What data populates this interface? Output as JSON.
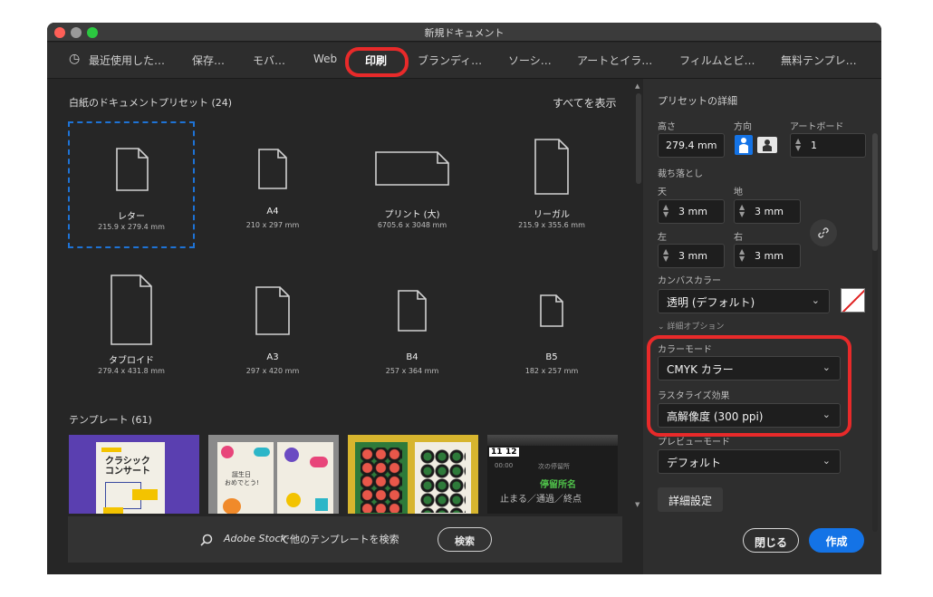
{
  "window": {
    "title": "新規ドキュメント"
  },
  "tabs": [
    {
      "label": "最近使用した…"
    },
    {
      "label": "保存…"
    },
    {
      "label": "モバ…"
    },
    {
      "label": "Web"
    },
    {
      "label": "印刷"
    },
    {
      "label": "ブランディ…"
    },
    {
      "label": "ソーシ…"
    },
    {
      "label": "アートとイラ…"
    },
    {
      "label": "フィルムとビ…"
    },
    {
      "label": "無料テンプレ…"
    }
  ],
  "presets_section": {
    "title": "白紙のドキュメントプリセット (24)",
    "show_all": "すべてを表示"
  },
  "presets": [
    {
      "name": "レター",
      "size": "215.9 x 279.4 mm"
    },
    {
      "name": "A4",
      "size": "210 x 297 mm"
    },
    {
      "name": "プリント (大)",
      "size": "6705.6 x 3048 mm"
    },
    {
      "name": "リーガル",
      "size": "215.9 x 355.6 mm"
    },
    {
      "name": "タブロイド",
      "size": "279.4 x 431.8 mm"
    },
    {
      "name": "A3",
      "size": "297 x 420 mm"
    },
    {
      "name": "B4",
      "size": "257 x 364 mm"
    },
    {
      "name": "B5",
      "size": "182 x 257 mm"
    }
  ],
  "templates": {
    "title": "テンプレート (61)",
    "t1": {
      "line1": "クラシック",
      "line2": "コンサート"
    },
    "t2": {
      "line1": "誕生日",
      "line2": "おめでとう!"
    },
    "t4": {
      "num1": "11",
      "num2": "12",
      "time": "00:00",
      "label": "次の停留所",
      "stop": "停留所名",
      "bottom": "止まる／通過／終点"
    }
  },
  "search": {
    "brand": "Adobe Stock",
    "text": "で他のテンプレートを検索",
    "button": "検索"
  },
  "details": {
    "title": "プリセットの詳細",
    "height_label": "高さ",
    "height_value": "279.4 mm",
    "orientation_label": "方向",
    "artboard_label": "アートボード",
    "artboard_value": "1",
    "bleed_label": "裁ち落とし",
    "top_label": "天",
    "top_value": "3 mm",
    "bottom_label": "地",
    "bottom_value": "3 mm",
    "left_label": "左",
    "left_value": "3 mm",
    "right_label": "右",
    "right_value": "3 mm",
    "canvas_label": "カンバスカラー",
    "canvas_value": "透明 (デフォルト)",
    "advanced_label": "詳細オプション",
    "color_mode_label": "カラーモード",
    "color_mode_value": "CMYK カラー",
    "raster_label": "ラスタライズ効果",
    "raster_value": "高解像度 (300 ppi)",
    "preview_label": "プレビューモード",
    "preview_value": "デフォルト",
    "more_settings": "詳細設定"
  },
  "actions": {
    "close": "閉じる",
    "create": "作成"
  },
  "colors": {
    "accent": "#1473e6",
    "highlight_ring": "#e82a2a",
    "dialog_bg": "#262626",
    "panel_bg": "#2e2e2e"
  }
}
